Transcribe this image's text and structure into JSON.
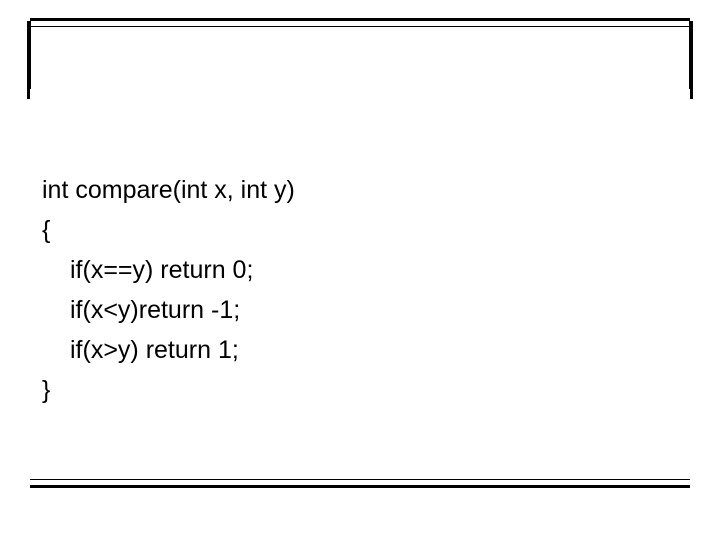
{
  "code": {
    "line1": "int compare(int x, int y)",
    "line2": "{",
    "line3": "if(x==y) return 0;",
    "line4": "if(x<y)return -1;",
    "line5": "if(x>y) return 1;",
    "line6": "}"
  }
}
